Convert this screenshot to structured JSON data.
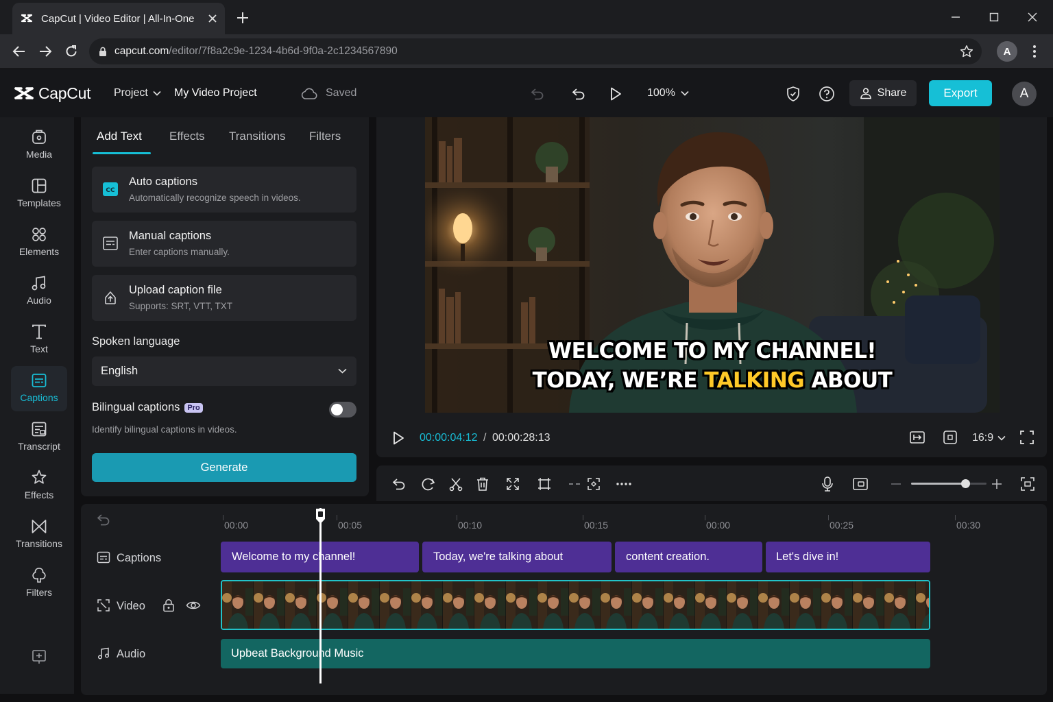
{
  "browser": {
    "tab_title": "CapCut | Video Editor | All-In-One",
    "url_domain": "capcut.com",
    "url_path": "/editor/7f8a2c9e-1234-4b6d-9f0a-2c1234567890",
    "profile_initial": "A"
  },
  "header": {
    "logo_text": "CapCut",
    "project_menu": "Project",
    "project_name": "My Video Project",
    "save_status": "Saved",
    "zoom": "100%",
    "share_label": "Share",
    "export_label": "Export",
    "user_initial": "A",
    "accent_color": "#16bfd6"
  },
  "sidebar": {
    "items": [
      {
        "label": "Media",
        "icon": "media-icon"
      },
      {
        "label": "Templates",
        "icon": "templates-icon"
      },
      {
        "label": "Elements",
        "icon": "elements-icon"
      },
      {
        "label": "Audio",
        "icon": "audio-icon"
      },
      {
        "label": "Text",
        "icon": "text-icon"
      },
      {
        "label": "Captions",
        "icon": "captions-icon",
        "active": true
      },
      {
        "label": "Transcript",
        "icon": "transcript-icon"
      },
      {
        "label": "Effects",
        "icon": "effects-icon"
      },
      {
        "label": "Transitions",
        "icon": "transitions-icon"
      },
      {
        "label": "Filters",
        "icon": "filters-icon"
      }
    ]
  },
  "panel": {
    "tabs": [
      "Add Text",
      "Effects",
      "Transitions",
      "Filters"
    ],
    "active_tab": "Add Text",
    "cards": [
      {
        "title": "Auto captions",
        "desc": "Automatically recognize speech in videos."
      },
      {
        "title": "Manual captions",
        "desc": "Enter captions manually."
      },
      {
        "title": "Upload caption file",
        "desc": "Supports: SRT, VTT, TXT"
      }
    ],
    "spoken_language_label": "Spoken language",
    "spoken_language_value": "English",
    "bilingual_label": "Bilingual captions",
    "pro_badge": "Pro",
    "bilingual_enabled": false,
    "bilingual_desc": "Identify bilingual captions in videos.",
    "generate_label": "Generate"
  },
  "preview": {
    "caption_line1": "WELCOME TO MY CHANNEL!",
    "caption_line2_a": "TODAY, WE’RE",
    "caption_line2_highlight": "TALKING",
    "caption_line2_b": "ABOUT",
    "highlight_color": "#ffc928",
    "current_time": "00:00:04:12",
    "time_separator": "/",
    "total_time": "00:00:28:13",
    "aspect_ratio": "16:9"
  },
  "timeline": {
    "ticks": [
      "00:00",
      "00:05",
      "00:10",
      "00:15",
      "00:00",
      "00:25",
      "00:30"
    ],
    "tracks": {
      "captions": "Captions",
      "video": "Video",
      "audio": "Audio"
    },
    "caption_clips": [
      "Welcome to my channel!",
      "Today, we're talking about",
      "content creation.",
      "Let's dive in!"
    ],
    "audio_clip": "Upbeat Background Music",
    "zoom_level": 0.72
  }
}
